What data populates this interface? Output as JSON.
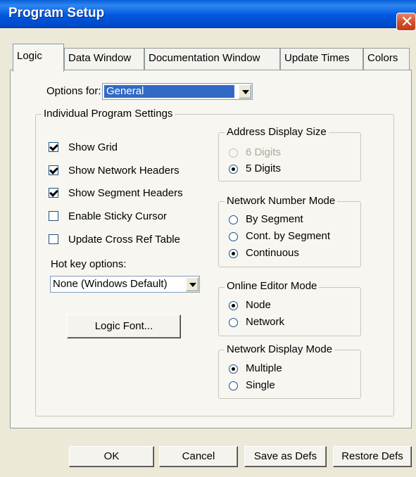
{
  "window": {
    "title": "Program Setup"
  },
  "tabs": [
    "Logic",
    "Data Window",
    "Documentation Window",
    "Update Times",
    "Colors"
  ],
  "options_for": {
    "label": "Options for:",
    "value": "General"
  },
  "individual_settings": {
    "legend": "Individual Program Settings",
    "checkboxes": [
      {
        "label": "Show Grid",
        "checked": true
      },
      {
        "label": "Show Network Headers",
        "checked": true
      },
      {
        "label": "Show Segment Headers",
        "checked": true
      },
      {
        "label": "Enable Sticky Cursor",
        "checked": false
      },
      {
        "label": "Update Cross Ref Table",
        "checked": false
      }
    ],
    "hotkey_label": "Hot key options:",
    "hotkey_value": "None (Windows Default)",
    "logic_font_button": "Logic Font..."
  },
  "address_display": {
    "legend": "Address Display Size",
    "options": [
      "6 Digits",
      "5 Digits"
    ],
    "selected": "5 Digits",
    "disabled": [
      "6 Digits"
    ]
  },
  "network_number": {
    "legend": "Network Number Mode",
    "options": [
      "By Segment",
      "Cont. by Segment",
      "Continuous"
    ],
    "selected": "Continuous"
  },
  "online_editor": {
    "legend": "Online Editor Mode",
    "options": [
      "Node",
      "Network"
    ],
    "selected": "Node"
  },
  "network_display": {
    "legend": "Network Display Mode",
    "options": [
      "Multiple",
      "Single"
    ],
    "selected": "Multiple"
  },
  "buttons": {
    "ok": "OK",
    "cancel": "Cancel",
    "save_defs": "Save as Defs",
    "restore_defs": "Restore Defs"
  }
}
